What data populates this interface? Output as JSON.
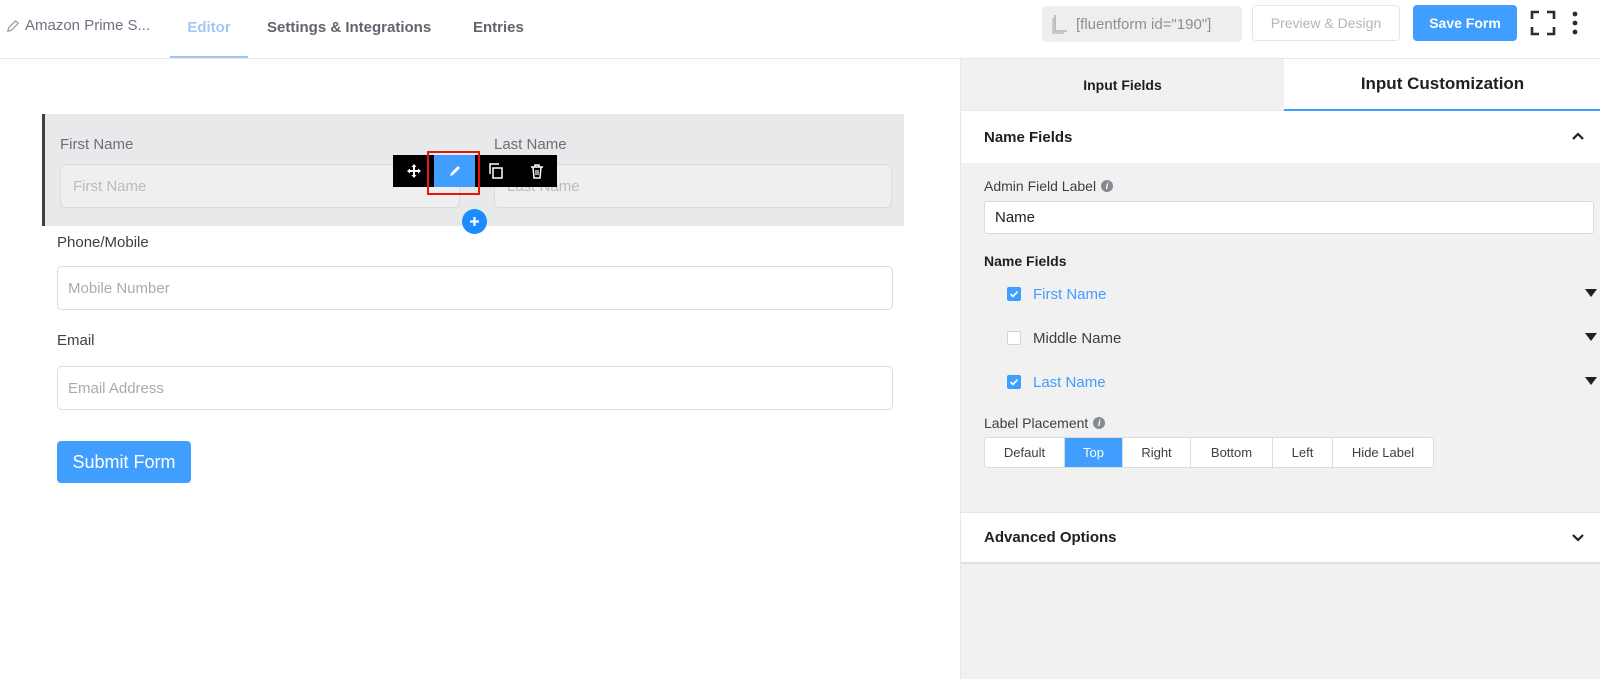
{
  "header": {
    "form_name": "Amazon Prime S...",
    "tabs": [
      {
        "label": "Editor"
      },
      {
        "label": "Settings & Integrations"
      },
      {
        "label": "Entries"
      }
    ],
    "shortcode": "[fluentform id=\"190\"]",
    "preview_label": "Preview & Design",
    "save_label": "Save Form"
  },
  "form": {
    "first_name": {
      "label": "First Name",
      "placeholder": "First Name"
    },
    "last_name": {
      "label": "Last Name",
      "placeholder": "Last Name"
    },
    "phone": {
      "label": "Phone/Mobile",
      "placeholder": "Mobile Number"
    },
    "email": {
      "label": "Email",
      "placeholder": "Email Address"
    },
    "submit_label": "Submit Form"
  },
  "panel": {
    "tabs": [
      {
        "label": "Input Fields"
      },
      {
        "label": "Input Customization"
      }
    ],
    "section_title": "Name Fields",
    "admin_label": "Admin Field Label",
    "admin_value": "Name",
    "name_fields_title": "Name Fields",
    "name_fields": [
      {
        "label": "First Name",
        "checked": true
      },
      {
        "label": "Middle Name",
        "checked": false
      },
      {
        "label": "Last Name",
        "checked": true
      }
    ],
    "label_placement": "Label Placement",
    "placements": [
      "Default",
      "Top",
      "Right",
      "Bottom",
      "Left",
      "Hide Label"
    ],
    "selected_placement": "Top",
    "advanced_title": "Advanced Options"
  },
  "colors": {
    "accent": "#409eff",
    "highlight": "#e3170a"
  }
}
